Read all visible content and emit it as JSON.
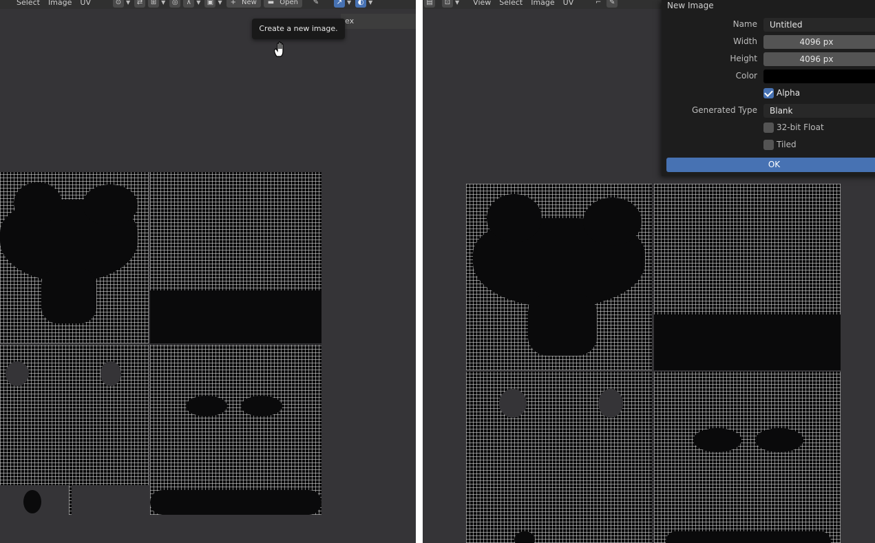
{
  "left_editor": {
    "menu": [
      "Select",
      "Image",
      "UV"
    ],
    "new_button": "New",
    "open_button": "Open",
    "tab_fragment": "ex",
    "tooltip": "Create a new image."
  },
  "right_editor": {
    "menu": [
      "View",
      "Select",
      "Image",
      "UV"
    ]
  },
  "new_image_dialog": {
    "title": "New Image",
    "name_label": "Name",
    "name_value": "Untitled",
    "width_label": "Width",
    "width_value": "4096 px",
    "height_label": "Height",
    "height_value": "4096 px",
    "color_label": "Color",
    "color_value": "#000000",
    "alpha_label": "Alpha",
    "alpha_checked": true,
    "generated_type_label": "Generated Type",
    "generated_type_value": "Blank",
    "float_label": "32-bit Float",
    "float_checked": false,
    "tiled_label": "Tiled",
    "tiled_checked": false,
    "ok_label": "OK"
  },
  "colors": {
    "editor_bg": "#353437",
    "header_bg": "#303030",
    "dialog_bg": "#1d1d1d",
    "accent_blue": "#4772b3",
    "uv_wire": "#e6e6e6"
  }
}
